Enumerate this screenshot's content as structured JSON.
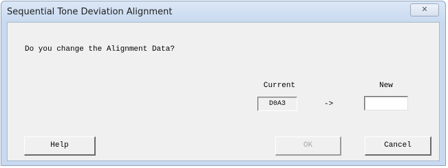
{
  "window": {
    "title": "Sequential Tone Deviation Alignment",
    "close_glyph": "✕"
  },
  "dialog": {
    "prompt": "Do you change the Alignment Data?",
    "current_label": "Current",
    "new_label": "New",
    "current_value": "D0A3",
    "arrow": "->",
    "new_value": ""
  },
  "buttons": {
    "help": "Help",
    "ok": "OK",
    "ok_enabled": false,
    "cancel": "Cancel"
  }
}
